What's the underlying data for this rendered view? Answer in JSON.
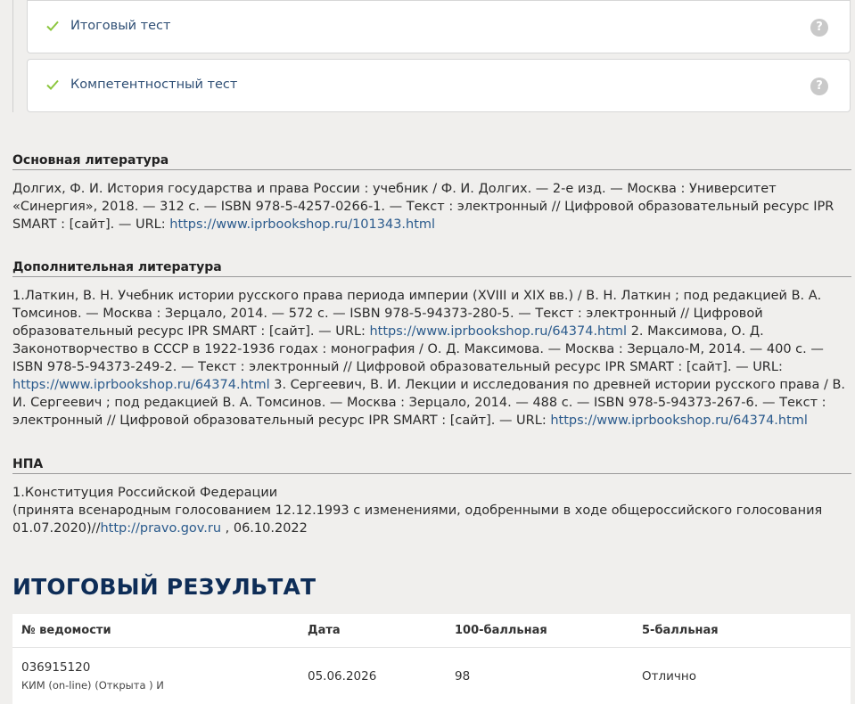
{
  "tests": [
    {
      "label": "Итоговый тест",
      "help": "?"
    },
    {
      "label": "Компетентностный тест",
      "help": "?"
    }
  ],
  "sections": {
    "main": {
      "title": "Основная литература",
      "text1": "Долгих, Ф. И. История государства и права России : учебник / Ф. И. Долгих. — 2-е изд. — Москва : Университет «Синергия», 2018. — 312 с. — ISBN 978-5-4257-0266-1. — Текст : электронный // Цифровой образовательный ресурс IPR SMART : [сайт]. — URL: ",
      "link1": "https://www.iprbookshop.ru/101343.html"
    },
    "additional": {
      "title": "Дополнительная литература",
      "text1": "1.Латкин, В. Н. Учебник истории русского права периода империи (XVIII и XIX вв.) / В. Н. Латкин ; под редакцией В. А. Томсинов. — Москва : Зерцало, 2014. — 572 с. — ISBN 978-5-94373-280-5. — Текст : электронный // Цифровой образовательный ресурс IPR SMART : [сайт]. — URL: ",
      "link1": "https://www.iprbookshop.ru/64374.html",
      "text2": " 2. Максимова, О. Д. Законотворчество в СССР в 1922-1936 годах : монография / О. Д. Максимова. — Москва : Зерцало-М, 2014. — 400 с. — ISBN 978-5-94373-249-2. — Текст : электронный // Цифровой образовательный ресурс IPR SMART : [сайт]. — URL: ",
      "link2": "https://www.iprbookshop.ru/64374.html",
      "text3": " 3. Сергеевич, В. И. Лекции и исследования по древней истории русского права / В. И. Сергеевич ; под редакцией В. А. Томсинов. — Москва : Зерцало, 2014. — 488 с. — ISBN 978-5-94373-267-6. — Текст : электронный // Цифровой образовательный ресурс IPR SMART : [сайт]. — URL: ",
      "link3": "https://www.iprbookshop.ru/64374.html"
    },
    "npa": {
      "title": "НПА",
      "line1": "1.Конституция Российской Федерации",
      "text2": "(принята всенародным голосованием 12.12.1993 с изменениями, одобренными в ходе общероссийского голосования 01.07.2020)//",
      "link1": "http://pravo.gov.ru",
      "text3": " , 06.10.2022"
    }
  },
  "result": {
    "title": "ИТОГОВЫЙ РЕЗУЛЬТАТ",
    "headers": [
      "№ ведомости",
      "Дата",
      "100-балльная",
      "5-балльная"
    ],
    "row": {
      "number": "036915120",
      "type": "КИМ (on-line) (Открыта ) И",
      "date": "05.06.2026",
      "score100": "98",
      "score5": "Отлично"
    }
  },
  "colors": {
    "accent": "#0e2d57",
    "link": "#2a5a8c",
    "check": "#8cc63e"
  }
}
